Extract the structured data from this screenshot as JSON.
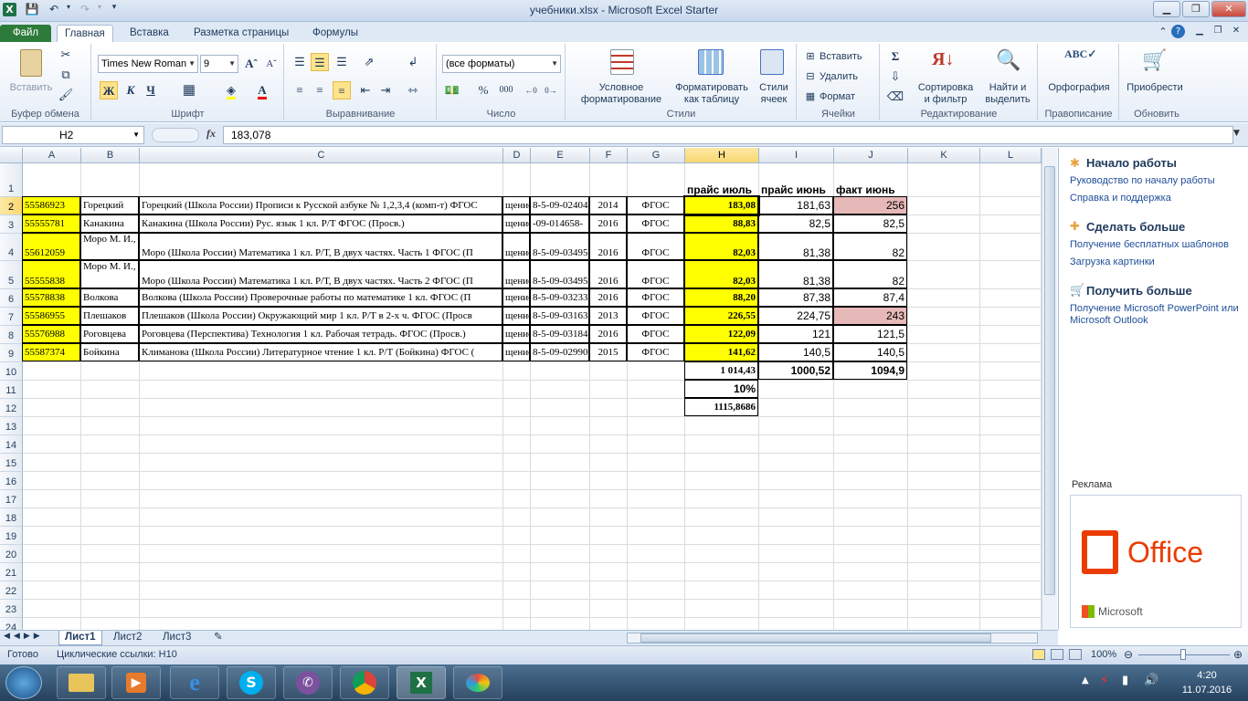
{
  "window": {
    "title": "учебники.xlsx - Microsoft Excel Starter",
    "app_icon": "excel-icon",
    "min": "▁",
    "max": "❐",
    "close": "✕"
  },
  "tabs": [
    "Файл",
    "Главная",
    "Вставка",
    "Разметка страницы",
    "Формулы"
  ],
  "ribbon": {
    "clipboard": {
      "paste": "Вставить",
      "label": "Буфер обмена"
    },
    "font": {
      "name": "Times New Roman",
      "size": "9",
      "bold": "Ж",
      "italic": "К",
      "underline": "Ч",
      "label": "Шрифт"
    },
    "alignment": {
      "label": "Выравнивание"
    },
    "number": {
      "format": "(все форматы)",
      "percent": "%",
      "thousands": "000",
      "label": "Число"
    },
    "styles": {
      "conditional": "Условное\nформатирование",
      "as_table": "Форматировать\nкак таблицу",
      "cell_styles": "Стили\nячеек",
      "label": "Стили"
    },
    "cells": {
      "insert": "Вставить",
      "delete": "Удалить",
      "format": "Формат",
      "label": "Ячейки"
    },
    "editing": {
      "sum": "Σ",
      "sort": "Сортировка\nи фильтр",
      "find": "Найти и\nвыделить",
      "label": "Редактирование"
    },
    "proofing": {
      "spelling": "Орфография",
      "label": "Правописание"
    },
    "update": {
      "upgrade": "Приобрести",
      "label": "Обновить"
    }
  },
  "formula_bar": {
    "name_box": "H2",
    "fx": "fx",
    "content": "183,078"
  },
  "columns": [
    "A",
    "B",
    "C",
    "D",
    "E",
    "F",
    "G",
    "H",
    "I",
    "J",
    "K",
    "L"
  ],
  "rows": [
    "1",
    "2",
    "3",
    "4",
    "5",
    "6",
    "7",
    "8",
    "9",
    "10",
    "11",
    "12",
    "13",
    "14",
    "15",
    "16",
    "17",
    "18",
    "19",
    "20",
    "21",
    "22",
    "23",
    "24"
  ],
  "headers_row1": {
    "H": "прайс июль",
    "I": "прайс июнь",
    "J": "факт июнь"
  },
  "data_rows": [
    {
      "A": "55586923",
      "B": "Горецкий",
      "C": "Горецкий (Школа России) Прописи к Русской азбуке № 1,2,3,4 (комп-т) ФГОС",
      "D": "щение",
      "E": "8-5-09-02404",
      "F": "2014",
      "G": "ФГОС",
      "H": "183,08",
      "I": "181,63",
      "J": "256"
    },
    {
      "A": "55555781",
      "B": "Канакина",
      "C": "Канакина (Школа России) Рус. язык 1 кл. Р/Т ФГОС (Просв.)",
      "D": "щение",
      "E": "-09-014658-",
      "F": "2016",
      "G": "ФГОС",
      "H": "88,83",
      "I": "82,5",
      "J": "82,5"
    },
    {
      "A": "55612059",
      "B": "Моро М. И.,",
      "C": "Моро (Школа России) Математика 1 кл. Р/Т, В двух частях. Часть 1 ФГОС (П",
      "D": "щение",
      "E": "8-5-09-03495",
      "F": "2016",
      "G": "ФГОС",
      "H": "82,03",
      "I": "81,38",
      "J": "82"
    },
    {
      "A": "55555838",
      "B": "Моро М. И.,",
      "C": "Моро (Школа России) Математика 1 кл. Р/Т, В двух частях. Часть 2 ФГОС (П",
      "D": "щение",
      "E": "8-5-09-03495",
      "F": "2016",
      "G": "ФГОС",
      "H": "82,03",
      "I": "81,38",
      "J": "82"
    },
    {
      "A": "55578838",
      "B": "Волкова",
      "C": "Волкова (Школа России) Проверочные работы по математике 1 кл. ФГОС (П",
      "D": "щение",
      "E": "8-5-09-03233",
      "F": "2016",
      "G": "ФГОС",
      "H": "88,20",
      "I": "87,38",
      "J": "87,4"
    },
    {
      "A": "55586955",
      "B": "Плешаков",
      "C": "Плешаков (Школа России) Окружающий мир 1 кл. Р/Т в 2-х ч. ФГОС (Просв",
      "D": "щение",
      "E": "8-5-09-03163",
      "F": "2013",
      "G": "ФГОС",
      "H": "226,55",
      "I": "224,75",
      "J": "243"
    },
    {
      "A": "55576988",
      "B": "Роговцева",
      "C": "Роговцева (Перспектива) Технология 1 кл. Рабочая тетрадь. ФГОС  (Просв.)",
      "D": "щение",
      "E": "8-5-09-03184",
      "F": "2016",
      "G": "ФГОС",
      "H": "122,09",
      "I": "121",
      "J": "121,5"
    },
    {
      "A": "55587374",
      "B": "Бойкина",
      "C": "Климанова (Школа России) Литературное чтение 1 кл. Р/Т (Бойкина) ФГОС (",
      "D": "щение",
      "E": "8-5-09-02990",
      "F": "2015",
      "G": "ФГОС",
      "H": "141,62",
      "I": "140,5",
      "J": "140,5"
    }
  ],
  "totals": {
    "H10": "1 014,43",
    "I10": "1000,52",
    "J10": "1094,9",
    "H11": "10%",
    "H12": "1115,8686"
  },
  "side_pane": {
    "s1_title": "Начало работы",
    "s1_l1": "Руководство по началу работы",
    "s1_l2": "Справка и поддержка",
    "s2_title": "Сделать больше",
    "s2_l1": "Получение бесплатных шаблонов",
    "s2_l2": "Загрузка картинки",
    "s3_title": "Получить больше",
    "s3_l1": "Получение Microsoft PowerPoint или Microsoft Outlook",
    "ad_label": "Реклама",
    "ad_office": "Office",
    "ad_ms": "Microsoft"
  },
  "sheets": [
    "Лист1",
    "Лист2",
    "Лист3"
  ],
  "status": {
    "ready": "Готово",
    "circular": "Циклические ссылки: H10",
    "zoom": "100%"
  },
  "taskbar": {
    "time": "4:20",
    "date": "11.07.2016"
  },
  "colors": {
    "yellow": "#ffff00",
    "pink": "#e6b8b7",
    "file_tab": "#2d7b3a"
  }
}
